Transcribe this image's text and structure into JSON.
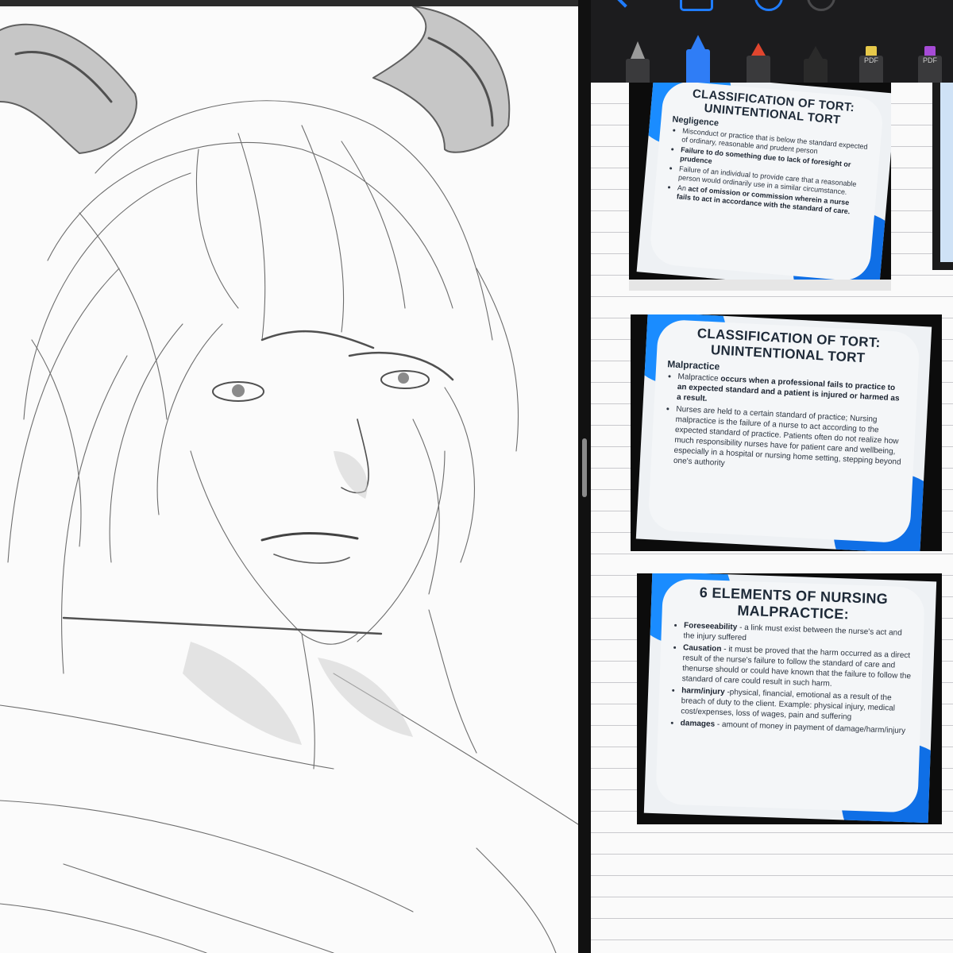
{
  "tools": [
    {
      "name": "fountain-pen-icon",
      "color": "#9a9a9a"
    },
    {
      "name": "blue-pen-icon",
      "color": "#2f7df6"
    },
    {
      "name": "red-pen-icon",
      "color": "#e0452e"
    },
    {
      "name": "pencil-icon",
      "color": "#2a2a2a"
    },
    {
      "name": "yellow-highlighter-icon",
      "color": "#e6c84a",
      "label": "PDF"
    },
    {
      "name": "purple-highlighter-icon",
      "color": "#a64bd6",
      "label": "PDF"
    }
  ],
  "slides": [
    {
      "title_line1": "CLASSIFICATION OF TORT:",
      "title_line2": "UNINTENTIONAL TORT",
      "subtitle": "Negligence",
      "bullets": [
        {
          "plain": "Misconduct or practice that is below the standard expected of ordinary, reasonable and prudent person"
        },
        {
          "bold": "Failure to do something due to lack of foresight or prudence"
        },
        {
          "plain": "Failure of an individual to provide care that a reasonable person would ordinarily use in a similar circumstance."
        },
        {
          "pre": "An ",
          "bold": "act of omission or commission wherein a nurse fails to act in accordance with the standard of care."
        }
      ]
    },
    {
      "title_line1": "CLASSIFICATION OF TORT:",
      "title_line2": "UNINTENTIONAL TORT",
      "subtitle": "Malpractice",
      "bullets": [
        {
          "pre": "Malpractice ",
          "bold": "occurs when a professional fails to practice to an expected standard and a patient is injured or harmed as a result."
        },
        {
          "plain": "Nurses are held to a certain standard of practice; Nursing malpractice is the failure of a nurse to act according to the expected standard of practice. Patients often do not realize how much responsibility nurses have for patient care and wellbeing, especially in a hospital or nursing home setting, stepping beyond one's authority"
        }
      ]
    },
    {
      "title_line1": "6 ELEMENTS OF NURSING",
      "title_line2": "MALPRACTICE:",
      "bullets": [
        {
          "bold": "Foreseeability",
          "rest": " - a link must exist between the nurse's act and the injury suffered"
        },
        {
          "bold": "Causation",
          "rest": " - it must be proved that the harm occurred as a direct result of the nurse's failure to follow the standard of care and thenurse should or could have known that the failure to follow the standard of care could result in such harm."
        },
        {
          "bold": "harm/injury",
          "rest": " -physical, financial, emotional as a result of the breach of duty to the client. Example: physical injury, medical cost/expenses, loss of wages, pain and suffering"
        },
        {
          "bold": "damages",
          "rest": " - amount of money in payment of damage/harm/injury"
        }
      ]
    }
  ],
  "colors": {
    "accent": "#1f7cff",
    "slide_blue": "#1a8cff",
    "paper": "#fafafa",
    "rule": "#c9c9cd"
  }
}
